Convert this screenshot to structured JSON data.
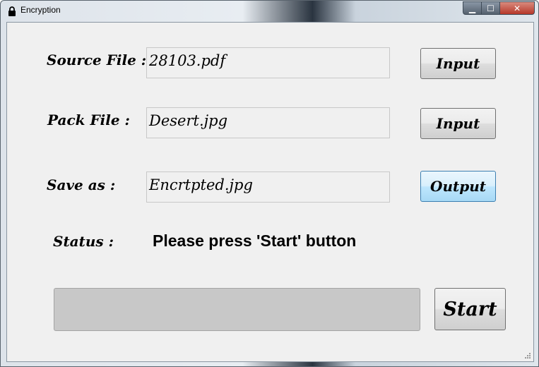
{
  "window": {
    "title": "Encryption",
    "minimize_glyph": "▁",
    "maximize_glyph": "☐",
    "close_glyph": "✕"
  },
  "form": {
    "source": {
      "label": "Source File :",
      "value": "28103.pdf",
      "button": "Input"
    },
    "pack": {
      "label": "Pack File :",
      "value": "Desert.jpg",
      "button": "Input"
    },
    "save": {
      "label": "Save as :",
      "value": "Encrtpted.jpg",
      "button": "Output"
    },
    "status": {
      "label": "Status :",
      "message": "Please press 'Start' button"
    },
    "progress": {
      "value": 0
    },
    "start_button": "Start"
  },
  "colors": {
    "focus_border": "#3c7fb1",
    "client_bg": "#f0f0f0",
    "close_button": "#c0392b"
  }
}
